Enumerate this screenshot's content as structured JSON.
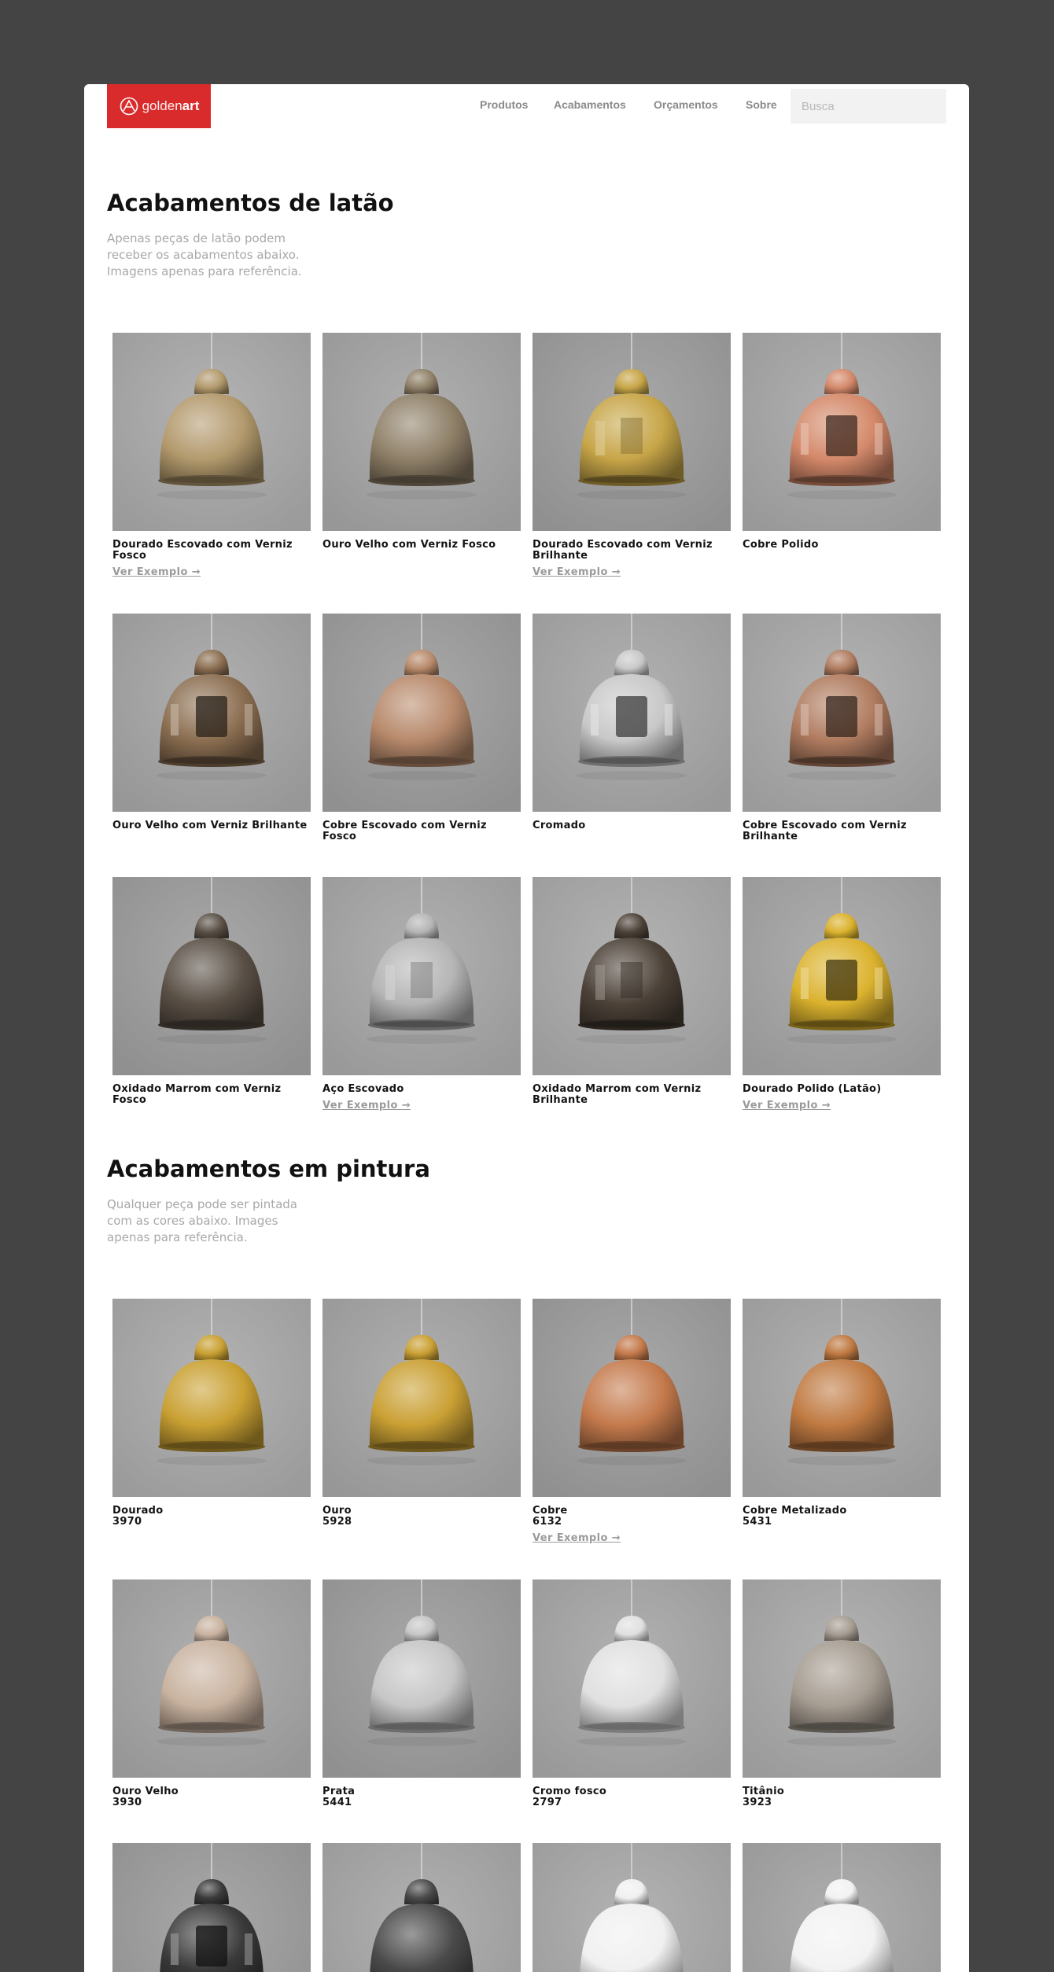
{
  "header": {
    "logo_light": "golden",
    "logo_bold": "art",
    "nav": [
      "Produtos",
      "Acabamentos",
      "Orçamentos",
      "Sobre"
    ],
    "search_placeholder": "Busca"
  },
  "brass": {
    "title": "Acabamentos de latão",
    "intro": "Apenas peças de latão podem receber os acabamentos abaixo. Imagens apenas para referência.",
    "items": [
      {
        "name": "Dourado Escovado com Verniz Fosco",
        "link": "Ver Exemplo →",
        "color": "#b39a6d",
        "gloss": "matte"
      },
      {
        "name": "Ouro Velho com Verniz Fosco",
        "color": "#8f8068",
        "gloss": "matte"
      },
      {
        "name": "Dourado Escovado com Verniz Brilhante",
        "link": "Ver Exemplo →",
        "color": "#c7a548",
        "gloss": "shiny"
      },
      {
        "name": "Cobre Polido",
        "color": "#d4896a",
        "gloss": "mirror"
      },
      {
        "name": "Ouro Velho com Verniz Brilhante",
        "color": "#8c6f52",
        "gloss": "mirror"
      },
      {
        "name": "Cobre Escovado com Verniz Fosco",
        "color": "#b88a6c",
        "gloss": "matte"
      },
      {
        "name": "Cromado",
        "color": "#c8c8c8",
        "gloss": "mirror"
      },
      {
        "name": "Cobre Escovado com Verniz Brilhante",
        "color": "#b07c60",
        "gloss": "mirror"
      },
      {
        "name": "Oxidado Marrom com Verniz Fosco",
        "color": "#5a5046",
        "gloss": "matte"
      },
      {
        "name": "Aço Escovado",
        "link": "Ver Exemplo →",
        "color": "#b5b5b5",
        "gloss": "shiny"
      },
      {
        "name": "Oxidado Marrom com Verniz Brilhante",
        "color": "#4c4238",
        "gloss": "shiny"
      },
      {
        "name": "Dourado Polido (Latão)",
        "link": "Ver Exemplo →",
        "color": "#dbb22e",
        "gloss": "mirror"
      }
    ]
  },
  "paint": {
    "title": "Acabamentos em pintura",
    "intro": "Qualquer peça pode ser pintada com as cores abaixo. Images apenas para referência.",
    "items": [
      {
        "name": "Dourado",
        "code": "3970",
        "color": "#c9a032",
        "gloss": "matte"
      },
      {
        "name": "Ouro",
        "code": "5928",
        "color": "#caa034",
        "gloss": "matte"
      },
      {
        "name": "Cobre",
        "code": "6132",
        "link": "Ver Exemplo →",
        "color": "#c47a4c",
        "gloss": "matte"
      },
      {
        "name": "Cobre Metalizado",
        "code": "5431",
        "color": "#c07a42",
        "gloss": "matte"
      },
      {
        "name": "Ouro Velho",
        "code": "3930",
        "color": "#c9b3a0",
        "gloss": "matte"
      },
      {
        "name": "Prata",
        "code": "5441",
        "color": "#c6c6c6",
        "gloss": "matte"
      },
      {
        "name": "Cromo fosco",
        "code": "2797",
        "color": "#e0e0e0",
        "gloss": "matte"
      },
      {
        "name": "Titânio",
        "code": "3923",
        "color": "#a69d92",
        "gloss": "matte"
      },
      {
        "name": "",
        "color": "#3a3a3a",
        "gloss": "mirror"
      },
      {
        "name": "",
        "color": "#4a4a4a",
        "gloss": "matte"
      },
      {
        "name": "",
        "color": "#f0f0f0",
        "gloss": "matte"
      },
      {
        "name": "",
        "color": "#f2f2f2",
        "gloss": "matte"
      }
    ]
  }
}
